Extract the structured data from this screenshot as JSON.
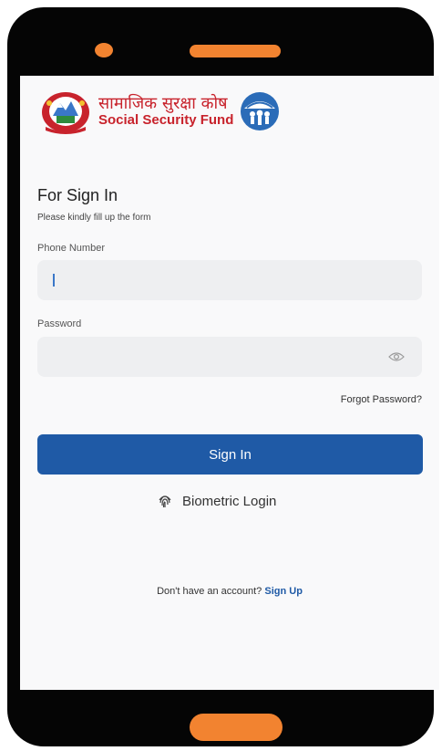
{
  "header": {
    "org_name_np": "सामाजिक सुरक्षा कोष",
    "org_name_en": "Social Security Fund"
  },
  "form": {
    "title": "For Sign In",
    "subtitle": "Please kindly fill up the form",
    "phone_label": "Phone Number",
    "phone_value": "",
    "password_label": "Password",
    "password_value": "",
    "forgot_password": "Forgot Password?",
    "signin_label": "Sign In",
    "biometric_label": "Biometric Login"
  },
  "footer": {
    "prompt": "Don't have an account?",
    "signup_label": "Sign Up"
  },
  "colors": {
    "primary": "#1f5aa6",
    "accent": "#f28330",
    "brand_red": "#c8232c"
  },
  "icons": [
    "nepal-emblem-icon",
    "ssf-logo-icon",
    "eye-icon",
    "fingerprint-icon"
  ]
}
